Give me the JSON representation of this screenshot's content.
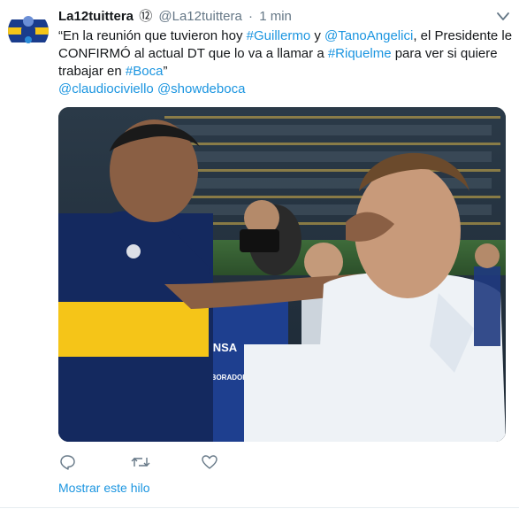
{
  "tweet": {
    "author_name": "La12tuittera",
    "badge": "⑫",
    "handle": "@La12tuittera",
    "separator": "·",
    "time": "1 min",
    "text_line1": {
      "t1": "“En la reunión que tuvieron hoy ",
      "l1": "#Guillermo",
      "t2": " y ",
      "l2": "@TanoAngelici",
      "t3": ", el Presidente le"
    },
    "text_line2": {
      "t1": "CONFIRMÓ al actual DT que lo va a llamar a ",
      "l1": "#Riquelme",
      "t2": " para ver si quiere"
    },
    "text_line3": {
      "t1": "trabajar en ",
      "l1": "#Boca",
      "t2": "”"
    },
    "text_line4": {
      "l1": "@claudiociviello",
      "t1": " ",
      "l2": "@showdeboca"
    },
    "media": {
      "vest_text1": "PRENSA",
      "vest_text2": "COLABORADOR"
    },
    "actions": {
      "reply_icon": "reply-icon",
      "retweet_icon": "retweet-icon",
      "like_icon": "heart-icon"
    },
    "show_thread": "Mostrar este hilo"
  },
  "colors": {
    "link": "#1b95e0",
    "muted": "#657786",
    "text": "#14171a",
    "boca_blue": "#1a3c8c",
    "boca_yellow": "#f5c518"
  }
}
